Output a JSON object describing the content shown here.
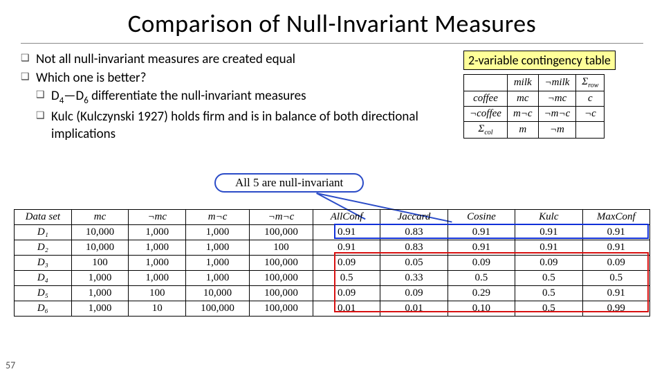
{
  "title": "Comparison of Null-Invariant Measures",
  "bullets": {
    "b1": "Not all null-invariant measures are created equal",
    "b2": "Which one is better?",
    "b2a_pre": "D",
    "b2a_sub1": "4",
    "b2a_mid": "—D",
    "b2a_sub2": "6",
    "b2a_post": " differentiate the null-invariant measures",
    "b2b": "Kulc (Kulczynski 1927) holds firm and is in balance of both directional implications"
  },
  "side_label": "2-variable contingency table",
  "ct": {
    "h_milk": "milk",
    "h_nmilk": "¬milk",
    "h_srow": "Σ",
    "r1": "coffee",
    "c_mc": "mc",
    "c_nmc": "¬mc",
    "c_c": "c",
    "r2": "¬coffee",
    "c_mnc": "m¬c",
    "c_nmnc": "¬m¬c",
    "c_nc": "¬c",
    "r3": "Σ",
    "c_m": "m",
    "c_nm": "¬m",
    "c_tot": ""
  },
  "annot": "All 5 are null-invariant",
  "dt": {
    "headers": [
      "Data set",
      "mc",
      "¬mc",
      "m¬c",
      "¬m¬c",
      "AllConf",
      "Jaccard",
      "Cosine",
      "Kulc",
      "MaxConf"
    ],
    "rows": [
      [
        "D₁",
        "10,000",
        "1,000",
        "1,000",
        "100,000",
        "0.91",
        "0.83",
        "0.91",
        "0.91",
        "0.91"
      ],
      [
        "D₂",
        "10,000",
        "1,000",
        "1,000",
        "100",
        "0.91",
        "0.83",
        "0.91",
        "0.91",
        "0.91"
      ],
      [
        "D₃",
        "100",
        "1,000",
        "1,000",
        "100,000",
        "0.09",
        "0.05",
        "0.09",
        "0.09",
        "0.09"
      ],
      [
        "D₄",
        "1,000",
        "1,000",
        "1,000",
        "100,000",
        "0.5",
        "0.33",
        "0.5",
        "0.5",
        "0.5"
      ],
      [
        "D₅",
        "1,000",
        "100",
        "10,000",
        "100,000",
        "0.09",
        "0.09",
        "0.29",
        "0.5",
        "0.91"
      ],
      [
        "D₆",
        "1,000",
        "10",
        "100,000",
        "100,000",
        "0.01",
        "0.01",
        "0.10",
        "0.5",
        "0.99"
      ]
    ]
  },
  "pagenum": "57",
  "chart_data": {
    "type": "table",
    "title": "Null-invariant measures over six data sets",
    "columns": [
      "Data set",
      "mc",
      "¬mc",
      "m¬c",
      "¬m¬c",
      "AllConf",
      "Jaccard",
      "Cosine",
      "Kulc",
      "MaxConf"
    ],
    "rows": [
      {
        "Data set": "D1",
        "mc": 10000,
        "¬mc": 1000,
        "m¬c": 1000,
        "¬m¬c": 100000,
        "AllConf": 0.91,
        "Jaccard": 0.83,
        "Cosine": 0.91,
        "Kulc": 0.91,
        "MaxConf": 0.91
      },
      {
        "Data set": "D2",
        "mc": 10000,
        "¬mc": 1000,
        "m¬c": 1000,
        "¬m¬c": 100,
        "AllConf": 0.91,
        "Jaccard": 0.83,
        "Cosine": 0.91,
        "Kulc": 0.91,
        "MaxConf": 0.91
      },
      {
        "Data set": "D3",
        "mc": 100,
        "¬mc": 1000,
        "m¬c": 1000,
        "¬m¬c": 100000,
        "AllConf": 0.09,
        "Jaccard": 0.05,
        "Cosine": 0.09,
        "Kulc": 0.09,
        "MaxConf": 0.09
      },
      {
        "Data set": "D4",
        "mc": 1000,
        "¬mc": 1000,
        "m¬c": 1000,
        "¬m¬c": 100000,
        "AllConf": 0.5,
        "Jaccard": 0.33,
        "Cosine": 0.5,
        "Kulc": 0.5,
        "MaxConf": 0.5
      },
      {
        "Data set": "D5",
        "mc": 1000,
        "¬mc": 100,
        "m¬c": 10000,
        "¬m¬c": 100000,
        "AllConf": 0.09,
        "Jaccard": 0.09,
        "Cosine": 0.29,
        "Kulc": 0.5,
        "MaxConf": 0.91
      },
      {
        "Data set": "D6",
        "mc": 1000,
        "¬mc": 10,
        "m¬c": 100000,
        "¬m¬c": 100000,
        "AllConf": 0.01,
        "Jaccard": 0.01,
        "Cosine": 0.1,
        "Kulc": 0.5,
        "MaxConf": 0.99
      }
    ]
  }
}
